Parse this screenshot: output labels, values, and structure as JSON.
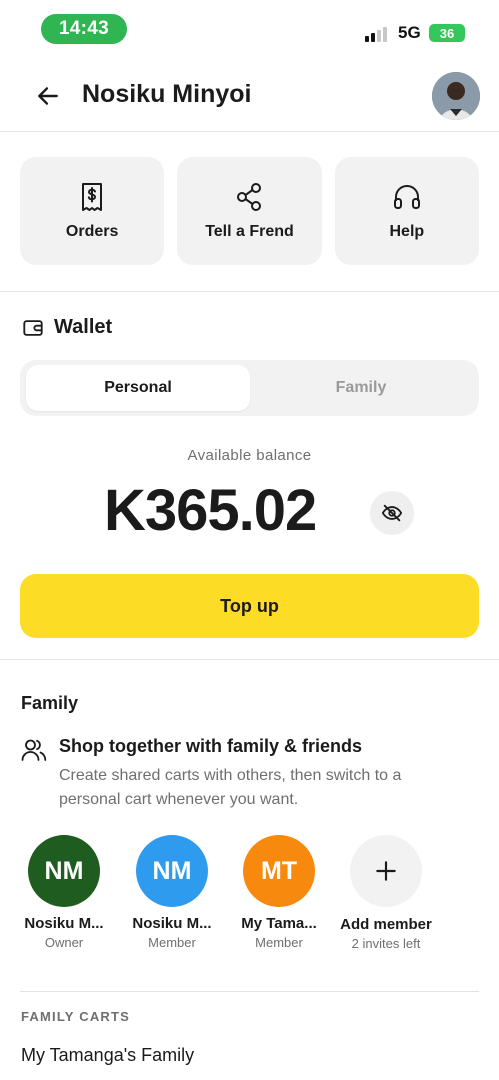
{
  "status_bar": {
    "time": "14:43",
    "network": "5G",
    "battery": "36"
  },
  "header": {
    "title": "Nosiku Minyoi",
    "back_icon": "arrow-left-icon"
  },
  "quick_actions": [
    {
      "label": "Orders",
      "icon": "receipt-icon"
    },
    {
      "label": "Tell a Frend",
      "icon": "share-icon"
    },
    {
      "label": "Help",
      "icon": "headphones-icon"
    }
  ],
  "wallet": {
    "title": "Wallet",
    "tabs": [
      {
        "label": "Personal",
        "active": true
      },
      {
        "label": "Family",
        "active": false
      }
    ],
    "balance_label": "Available balance",
    "balance": "K365.02",
    "top_up_label": "Top up"
  },
  "family": {
    "title": "Family",
    "promo_title": "Shop together with family & friends",
    "promo_desc": "Create shared carts with others, then switch to a personal cart whenever you want.",
    "members": [
      {
        "initials": "NM",
        "name": "Nosiku M...",
        "role": "Owner",
        "color": "#1f5c1f"
      },
      {
        "initials": "NM",
        "name": "Nosiku M...",
        "role": "Member",
        "color": "#2f9bef"
      },
      {
        "initials": "MT",
        "name": "My Tama...",
        "role": "Member",
        "color": "#f7890f"
      }
    ],
    "add_member": {
      "label": "Add member",
      "sub": "2 invites left"
    }
  },
  "family_carts": {
    "label": "FAMILY CARTS",
    "items": [
      "My Tamanga's Family"
    ]
  },
  "colors": {
    "accent_yellow": "#fcdc24",
    "status_green": "#2fb552"
  }
}
